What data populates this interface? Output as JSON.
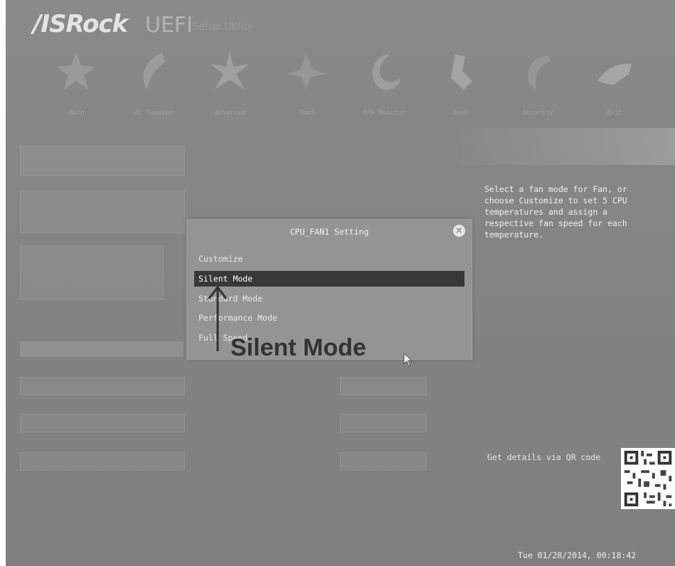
{
  "header": {
    "brand": "/ISRock",
    "product": "UEFI",
    "subtitle": "Setup Utility"
  },
  "nav": [
    {
      "label": "Main",
      "icon": "main-star-icon"
    },
    {
      "label": "OC Tweaker",
      "icon": "oc-tweaker-icon"
    },
    {
      "label": "Advanced",
      "icon": "advanced-star-icon"
    },
    {
      "label": "Tool",
      "icon": "tool-icon"
    },
    {
      "label": "H/W Monitor",
      "icon": "hw-monitor-icon"
    },
    {
      "label": "Boot",
      "icon": "boot-icon"
    },
    {
      "label": "Security",
      "icon": "security-icon"
    },
    {
      "label": "Exit",
      "icon": "exit-icon"
    }
  ],
  "dialog": {
    "title": "CPU_FAN1 Setting",
    "options": [
      {
        "label": "Customize",
        "selected": false
      },
      {
        "label": "Silent Mode",
        "selected": true
      },
      {
        "label": "Standard Mode",
        "selected": false
      },
      {
        "label": "Performance Mode",
        "selected": false
      },
      {
        "label": "Full Speed",
        "selected": false
      }
    ]
  },
  "description": "Select a fan mode for Fan, or choose Customize to set 5 CPU temperatures and assign a respective fan speed for each temperature.",
  "qr_label": "Get details via QR code",
  "datetime": "Tue 01/28/2014, 00:18:42",
  "callout": "Silent Mode",
  "colors": {
    "selected_bg": "#383838",
    "dialog_bg": "#949494",
    "screen_bg": "#858585"
  }
}
